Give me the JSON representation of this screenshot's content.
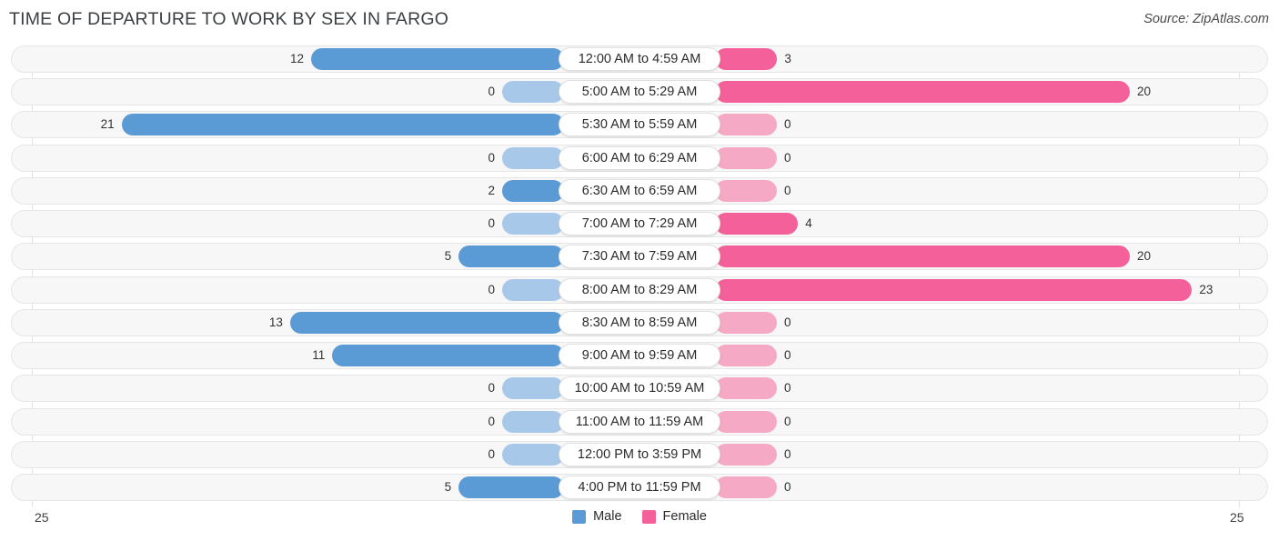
{
  "header": {
    "title": "TIME OF DEPARTURE TO WORK BY SEX IN FARGO",
    "source": "Source: ZipAtlas.com"
  },
  "axis": {
    "left_tick": "25",
    "right_tick": "25"
  },
  "legend": {
    "items": [
      {
        "label": "Male",
        "color": "#5b9bd5"
      },
      {
        "label": "Female",
        "color": "#f4619a"
      }
    ]
  },
  "chart_data": {
    "type": "bar",
    "title": "TIME OF DEPARTURE TO WORK BY SEX IN FARGO",
    "subtitle": "",
    "xlabel": "",
    "ylabel": "",
    "orientation": "horizontal-diverging",
    "grid": true,
    "legend_position": "bottom-center",
    "xlim": [
      25,
      25
    ],
    "axis_max": 25,
    "categories": [
      "12:00 AM to 4:59 AM",
      "5:00 AM to 5:29 AM",
      "5:30 AM to 5:59 AM",
      "6:00 AM to 6:29 AM",
      "6:30 AM to 6:59 AM",
      "7:00 AM to 7:29 AM",
      "7:30 AM to 7:59 AM",
      "8:00 AM to 8:29 AM",
      "8:30 AM to 8:59 AM",
      "9:00 AM to 9:59 AM",
      "10:00 AM to 10:59 AM",
      "11:00 AM to 11:59 AM",
      "12:00 PM to 3:59 PM",
      "4:00 PM to 11:59 PM"
    ],
    "series": [
      {
        "name": "Male",
        "color": "#5b9bd5",
        "side": "left",
        "values": [
          12,
          0,
          21,
          0,
          2,
          0,
          5,
          0,
          13,
          11,
          0,
          0,
          0,
          5
        ],
        "labels": [
          "12",
          "0",
          "21",
          "0",
          "2",
          "0",
          "5",
          "0",
          "13",
          "11",
          "0",
          "0",
          "0",
          "5"
        ]
      },
      {
        "name": "Female",
        "color": "#f4619a",
        "side": "right",
        "values": [
          3,
          20,
          0,
          0,
          0,
          4,
          20,
          23,
          0,
          0,
          0,
          0,
          0,
          0
        ],
        "labels": [
          "3",
          "20",
          "0",
          "0",
          "0",
          "4",
          "20",
          "23",
          "0",
          "0",
          "0",
          "0",
          "0",
          "0"
        ]
      }
    ]
  }
}
